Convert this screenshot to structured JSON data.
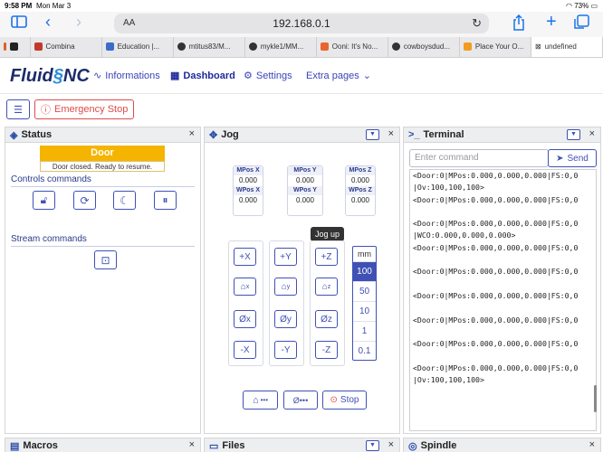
{
  "statusbar": {
    "time": "9:58 PM",
    "date": "Mon Mar 3",
    "battery": "73%"
  },
  "browser": {
    "aa": "AA",
    "url": "192.168.0.1",
    "tabs": [
      {
        "label": "Combina"
      },
      {
        "label": "Education |..."
      },
      {
        "label": "mtitus83/M..."
      },
      {
        "label": "mykle1/MM..."
      },
      {
        "label": "Ooni: It's No..."
      },
      {
        "label": "cowboysdud..."
      },
      {
        "label": "Place Your O..."
      },
      {
        "label": "undefined"
      }
    ]
  },
  "app": {
    "logo_a": "Fluid",
    "logo_b": "NC",
    "nav": {
      "informations": "Informations",
      "dashboard": "Dashboard",
      "settings": "Settings",
      "extra": "Extra pages"
    },
    "emergency": "Emergency Stop"
  },
  "status_panel": {
    "title": "Status",
    "state": "Door",
    "state_msg": "Door closed. Ready to resume.",
    "controls_title": "Controls commands",
    "stream_title": "Stream commands"
  },
  "jog_panel": {
    "title": "Jog",
    "mpos_x_label": "MPos X",
    "mpos_x": "0.000",
    "wpos_x_label": "WPos X",
    "wpos_x": "0.000",
    "mpos_y_label": "MPos Y",
    "mpos_y": "0.000",
    "wpos_y_label": "WPos Y",
    "wpos_y": "0.000",
    "mpos_z_label": "MPos Z",
    "mpos_z": "0.000",
    "wpos_z_label": "WPos Z",
    "wpos_z": "0.000",
    "tooltip": "Jog up",
    "x_plus": "+X",
    "x_minus": "-X",
    "x_zero": "Øx",
    "y_plus": "+Y",
    "y_minus": "-Y",
    "y_zero": "Øy",
    "z_plus": "+Z",
    "z_minus": "-Z",
    "z_zero": "Øz",
    "home_x": "x",
    "home_y": "y",
    "home_z": "z",
    "unit": "mm",
    "steps": [
      "100",
      "50",
      "10",
      "1",
      "0.1"
    ],
    "home_all": "•••",
    "zero_all": "Ø•••",
    "stop": "Stop"
  },
  "terminal_panel": {
    "title": "Terminal",
    "placeholder": "Enter command",
    "send": "Send",
    "lines": [
      "<Door:0|MPos:0.000,0.000,0.000|FS:0,0",
      "|Ov:100,100,100>",
      "<Door:0|MPos:0.000,0.000,0.000|FS:0,0",
      "",
      "<Door:0|MPos:0.000,0.000,0.000|FS:0,0",
      "|WCO:0.000,0.000,0.000>",
      "<Door:0|MPos:0.000,0.000,0.000|FS:0,0",
      "",
      "<Door:0|MPos:0.000,0.000,0.000|FS:0,0",
      "",
      "<Door:0|MPos:0.000,0.000,0.000|FS:0,0",
      "",
      "<Door:0|MPos:0.000,0.000,0.000|FS:0,0",
      "",
      "<Door:0|MPos:0.000,0.000,0.000|FS:0,0",
      "",
      "<Door:0|MPos:0.000,0.000,0.000|FS:0,0",
      "|Ov:100,100,100>"
    ]
  },
  "bottom_panels": {
    "macros": "Macros",
    "files": "Files",
    "spindle": "Spindle"
  }
}
